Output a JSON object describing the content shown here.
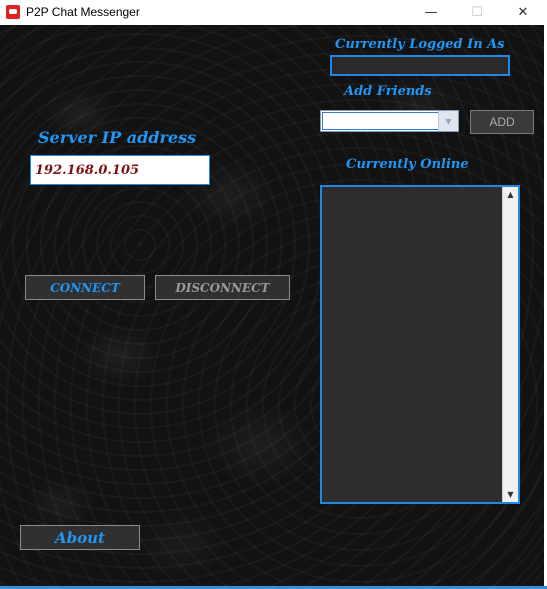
{
  "window": {
    "title": "P2P Chat Messenger",
    "controls": {
      "minimize": "—",
      "maximize": "☐",
      "close": "✕"
    }
  },
  "labels": {
    "currently_logged_in": "Currently Logged In As",
    "add_friends": "Add Friends",
    "server_ip": "Server IP address",
    "currently_online": "Currently Online"
  },
  "logged_in_user": "",
  "add_friends": {
    "selected_value": "",
    "button": "ADD",
    "dropdown_icon": "chevron-down-icon"
  },
  "server": {
    "ip_value": "192.168.0.105"
  },
  "buttons": {
    "connect": "CONNECT",
    "disconnect": "DISCONNECT",
    "about": "About"
  },
  "online_users": [],
  "scrollbar": {
    "up": "▲",
    "down": "▼"
  },
  "colors": {
    "accent": "#2196f3",
    "background": "#121212",
    "ip_text": "#7a1010"
  }
}
